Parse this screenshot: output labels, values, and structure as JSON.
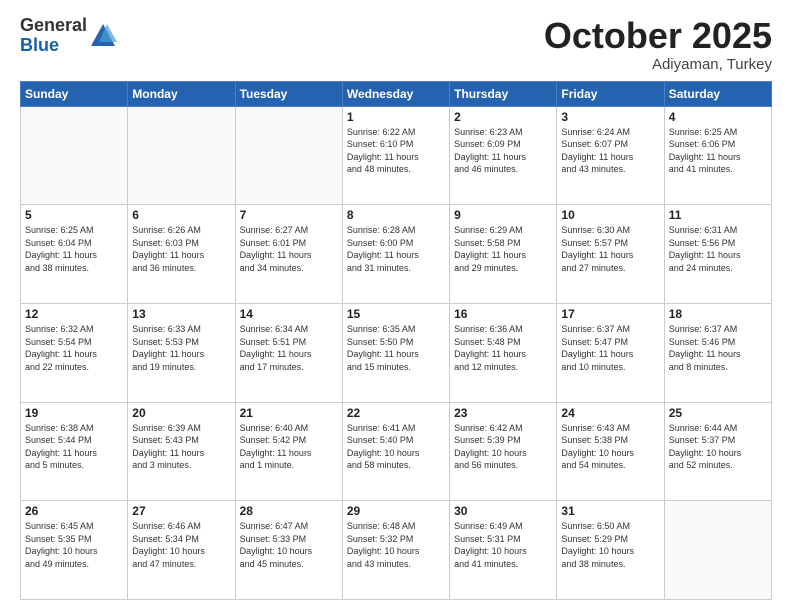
{
  "logo": {
    "general": "General",
    "blue": "Blue"
  },
  "header": {
    "month": "October 2025",
    "location": "Adiyaman, Turkey"
  },
  "weekdays": [
    "Sunday",
    "Monday",
    "Tuesday",
    "Wednesday",
    "Thursday",
    "Friday",
    "Saturday"
  ],
  "weeks": [
    [
      {
        "day": "",
        "info": ""
      },
      {
        "day": "",
        "info": ""
      },
      {
        "day": "",
        "info": ""
      },
      {
        "day": "1",
        "info": "Sunrise: 6:22 AM\nSunset: 6:10 PM\nDaylight: 11 hours\nand 48 minutes."
      },
      {
        "day": "2",
        "info": "Sunrise: 6:23 AM\nSunset: 6:09 PM\nDaylight: 11 hours\nand 46 minutes."
      },
      {
        "day": "3",
        "info": "Sunrise: 6:24 AM\nSunset: 6:07 PM\nDaylight: 11 hours\nand 43 minutes."
      },
      {
        "day": "4",
        "info": "Sunrise: 6:25 AM\nSunset: 6:06 PM\nDaylight: 11 hours\nand 41 minutes."
      }
    ],
    [
      {
        "day": "5",
        "info": "Sunrise: 6:25 AM\nSunset: 6:04 PM\nDaylight: 11 hours\nand 38 minutes."
      },
      {
        "day": "6",
        "info": "Sunrise: 6:26 AM\nSunset: 6:03 PM\nDaylight: 11 hours\nand 36 minutes."
      },
      {
        "day": "7",
        "info": "Sunrise: 6:27 AM\nSunset: 6:01 PM\nDaylight: 11 hours\nand 34 minutes."
      },
      {
        "day": "8",
        "info": "Sunrise: 6:28 AM\nSunset: 6:00 PM\nDaylight: 11 hours\nand 31 minutes."
      },
      {
        "day": "9",
        "info": "Sunrise: 6:29 AM\nSunset: 5:58 PM\nDaylight: 11 hours\nand 29 minutes."
      },
      {
        "day": "10",
        "info": "Sunrise: 6:30 AM\nSunset: 5:57 PM\nDaylight: 11 hours\nand 27 minutes."
      },
      {
        "day": "11",
        "info": "Sunrise: 6:31 AM\nSunset: 5:56 PM\nDaylight: 11 hours\nand 24 minutes."
      }
    ],
    [
      {
        "day": "12",
        "info": "Sunrise: 6:32 AM\nSunset: 5:54 PM\nDaylight: 11 hours\nand 22 minutes."
      },
      {
        "day": "13",
        "info": "Sunrise: 6:33 AM\nSunset: 5:53 PM\nDaylight: 11 hours\nand 19 minutes."
      },
      {
        "day": "14",
        "info": "Sunrise: 6:34 AM\nSunset: 5:51 PM\nDaylight: 11 hours\nand 17 minutes."
      },
      {
        "day": "15",
        "info": "Sunrise: 6:35 AM\nSunset: 5:50 PM\nDaylight: 11 hours\nand 15 minutes."
      },
      {
        "day": "16",
        "info": "Sunrise: 6:36 AM\nSunset: 5:48 PM\nDaylight: 11 hours\nand 12 minutes."
      },
      {
        "day": "17",
        "info": "Sunrise: 6:37 AM\nSunset: 5:47 PM\nDaylight: 11 hours\nand 10 minutes."
      },
      {
        "day": "18",
        "info": "Sunrise: 6:37 AM\nSunset: 5:46 PM\nDaylight: 11 hours\nand 8 minutes."
      }
    ],
    [
      {
        "day": "19",
        "info": "Sunrise: 6:38 AM\nSunset: 5:44 PM\nDaylight: 11 hours\nand 5 minutes."
      },
      {
        "day": "20",
        "info": "Sunrise: 6:39 AM\nSunset: 5:43 PM\nDaylight: 11 hours\nand 3 minutes."
      },
      {
        "day": "21",
        "info": "Sunrise: 6:40 AM\nSunset: 5:42 PM\nDaylight: 11 hours\nand 1 minute."
      },
      {
        "day": "22",
        "info": "Sunrise: 6:41 AM\nSunset: 5:40 PM\nDaylight: 10 hours\nand 58 minutes."
      },
      {
        "day": "23",
        "info": "Sunrise: 6:42 AM\nSunset: 5:39 PM\nDaylight: 10 hours\nand 56 minutes."
      },
      {
        "day": "24",
        "info": "Sunrise: 6:43 AM\nSunset: 5:38 PM\nDaylight: 10 hours\nand 54 minutes."
      },
      {
        "day": "25",
        "info": "Sunrise: 6:44 AM\nSunset: 5:37 PM\nDaylight: 10 hours\nand 52 minutes."
      }
    ],
    [
      {
        "day": "26",
        "info": "Sunrise: 6:45 AM\nSunset: 5:35 PM\nDaylight: 10 hours\nand 49 minutes."
      },
      {
        "day": "27",
        "info": "Sunrise: 6:46 AM\nSunset: 5:34 PM\nDaylight: 10 hours\nand 47 minutes."
      },
      {
        "day": "28",
        "info": "Sunrise: 6:47 AM\nSunset: 5:33 PM\nDaylight: 10 hours\nand 45 minutes."
      },
      {
        "day": "29",
        "info": "Sunrise: 6:48 AM\nSunset: 5:32 PM\nDaylight: 10 hours\nand 43 minutes."
      },
      {
        "day": "30",
        "info": "Sunrise: 6:49 AM\nSunset: 5:31 PM\nDaylight: 10 hours\nand 41 minutes."
      },
      {
        "day": "31",
        "info": "Sunrise: 6:50 AM\nSunset: 5:29 PM\nDaylight: 10 hours\nand 38 minutes."
      },
      {
        "day": "",
        "info": ""
      }
    ]
  ]
}
